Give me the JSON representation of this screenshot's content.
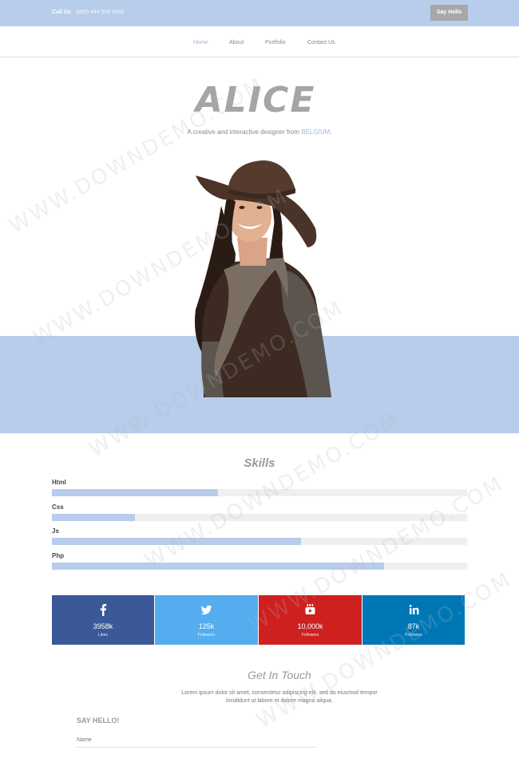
{
  "topbar": {
    "call_label": "Call Us",
    "phone": "(800) 444 555 6666",
    "say_hello_button": "Say Hello"
  },
  "nav": {
    "items": [
      "Home",
      "About",
      "Portfolio",
      "Contact Us"
    ],
    "active": "Home"
  },
  "hero": {
    "name": "ALICE",
    "tagline_prefix": "A creative and interactive designer from ",
    "tagline_highlight": "BELGIUM",
    "tagline_suffix": ".",
    "image": "portrait of woman in brown hat"
  },
  "skills": {
    "title": "Skills",
    "items": [
      {
        "label": "Html",
        "percent": 40
      },
      {
        "label": "Css",
        "percent": 20
      },
      {
        "label": "Js",
        "percent": 60
      },
      {
        "label": "Php",
        "percent": 80
      }
    ]
  },
  "social": [
    {
      "icon": "facebook-icon",
      "count": "3958k",
      "label": "Likes",
      "color": "#3b5998"
    },
    {
      "icon": "twitter-icon",
      "count": "125k",
      "label": "Followers",
      "color": "#55acee"
    },
    {
      "icon": "youtube-icon",
      "count": "10,000k",
      "label": "Followers",
      "color": "#cd201f"
    },
    {
      "icon": "linkedin-icon",
      "count": "87k",
      "label": "Followers",
      "color": "#0077b5"
    }
  ],
  "contact": {
    "title": "Get In Touch",
    "text": "Lorem ipsum dolor sit amet, consectetur adipiscing elit, sed do eiusmod tempor incididunt ut labore et dolore magna aliqua.",
    "form_heading": "SAY HELLO!",
    "name_placeholder": "Name"
  },
  "watermark": "WWW.DOWNDEMO.COM",
  "colors": {
    "accent": "#b8ccec",
    "accent_text": "#9fb6e0",
    "button_grey": "#a7a7a7"
  }
}
